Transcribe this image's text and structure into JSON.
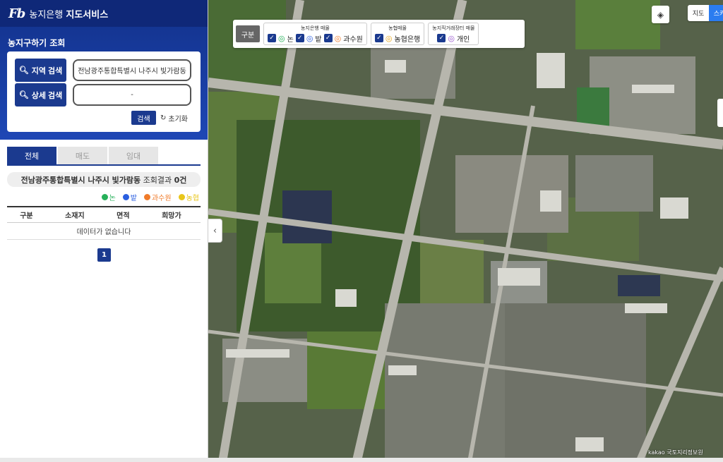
{
  "brand": {
    "logo": "Fb",
    "name": "농지은행",
    "service": "지도서비스"
  },
  "search": {
    "section_title": "농지구하기 조회",
    "region_button": "지역 검색",
    "detail_button": "상세 검색",
    "region_value": "전남광주통합특별시 나주시 빛가람동",
    "detail_value": "-",
    "submit_label": "검색",
    "reset_label": "초기화"
  },
  "tabs": [
    "전체",
    "매도",
    "임대"
  ],
  "result": {
    "region": "전남광주통합특별시 나주시 빛가람동",
    "suffix": "조회결과",
    "count": "0건"
  },
  "legend": [
    {
      "label": "논",
      "color": "#27b05a"
    },
    {
      "label": "밭",
      "color": "#2b5fe0"
    },
    {
      "label": "과수원",
      "color": "#f07b2a"
    },
    {
      "label": "농협",
      "color": "#e8c61a"
    }
  ],
  "table": {
    "headers": [
      "구분",
      "소재지",
      "면적",
      "희망가"
    ],
    "empty": "데이터가 없습니다"
  },
  "pagination": {
    "current": "1"
  },
  "map_filter": {
    "gubun": "구분",
    "group1_title": "농지은행 매물",
    "group1_items": [
      "논",
      "밭",
      "과수원"
    ],
    "group2_title": "농협매물",
    "group2_item": "농협은행",
    "group3_title": "농지직거래장터 매물",
    "group3_item": "개인"
  },
  "map_type": {
    "map": "지도",
    "sky": "스카"
  },
  "attribution": "kakao 국토지리정보원"
}
